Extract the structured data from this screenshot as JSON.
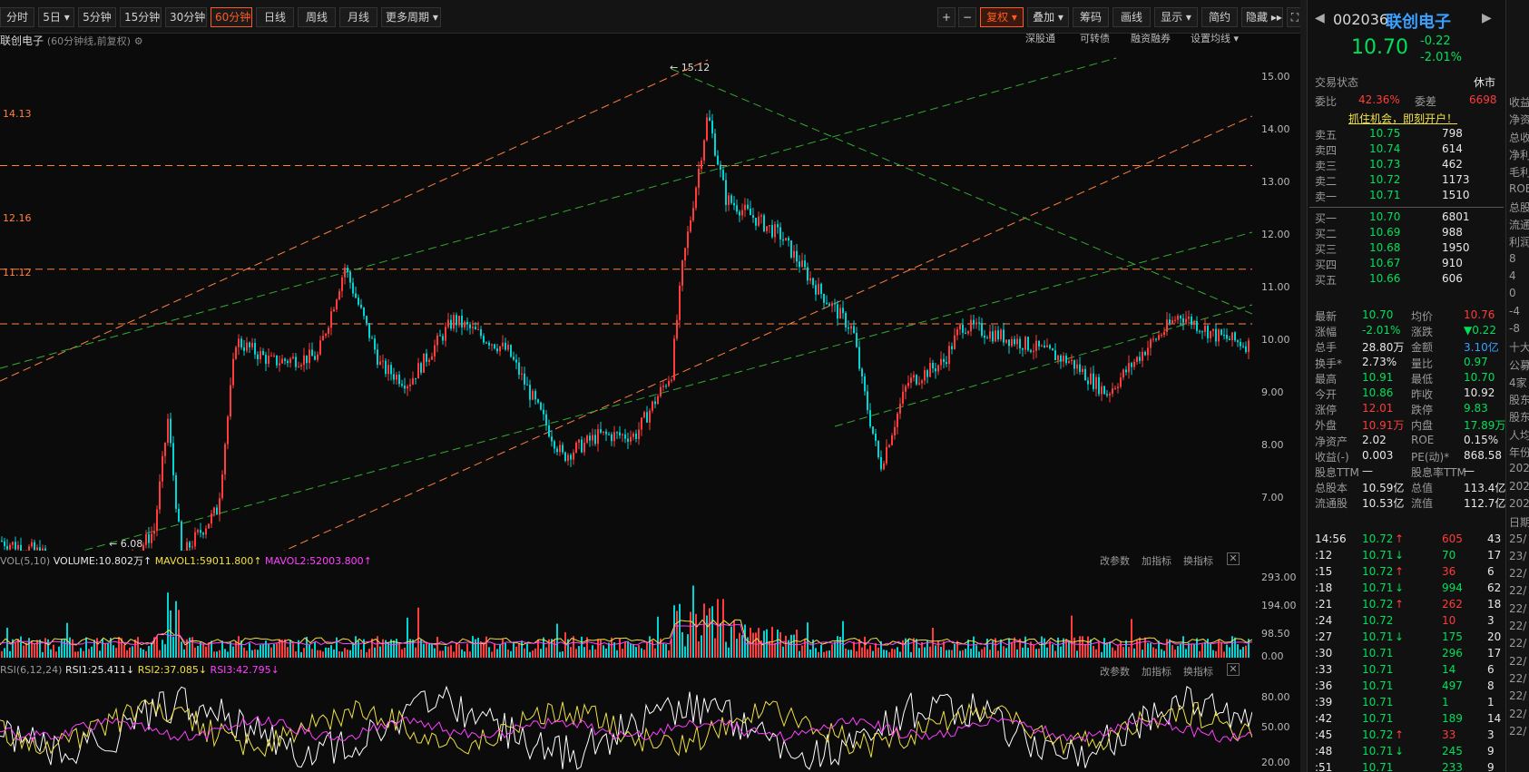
{
  "toolbar": {
    "periods": [
      "分时",
      "5日",
      "5分钟",
      "15分钟",
      "30分钟",
      "60分钟",
      "日线",
      "周线",
      "月线",
      "更多周期"
    ],
    "active_period": "60分钟",
    "tools": [
      "复权",
      "叠加",
      "筹码",
      "画线",
      "显示",
      "简约",
      "隐藏"
    ]
  },
  "chart": {
    "stock_name": "联创电子",
    "subtitle": "(60分钟线,前复权)",
    "links": [
      "深股通",
      "可转债",
      "融资融券",
      "设置均线"
    ],
    "price_axis": [
      "15.00",
      "14.00",
      "13.00",
      "12.00",
      "11.00",
      "10.00",
      "9.00",
      "8.00",
      "7.00"
    ],
    "hlines": [
      "14.13",
      "12.16",
      "11.12"
    ],
    "max_label": "15.12",
    "min_label": "6.08"
  },
  "volume_pane": {
    "name": "VOL(5,10)",
    "volume": "VOLUME:10.802万",
    "mavol1": "MAVOL1:59011.800",
    "mavol2": "MAVOL2:52003.800",
    "axis": [
      "293.00",
      "194.00",
      "98.50",
      "0.00"
    ],
    "tools": [
      "改参数",
      "加指标",
      "换指标"
    ]
  },
  "rsi_pane": {
    "name": "RSI(6,12,24)",
    "rsi1": "RSI1:25.411",
    "rsi2": "RSI2:37.085",
    "rsi3": "RSI3:42.795",
    "axis": [
      "80.00",
      "50.00",
      "20.00"
    ],
    "tools": [
      "改参数",
      "加指标",
      "换指标"
    ]
  },
  "quote": {
    "code": "002036",
    "name": "联创电子",
    "price": "10.70",
    "change": "-0.22",
    "change_pct": "-2.01%",
    "trade_status_label": "交易状态",
    "trade_status": "休市",
    "weibi_label": "委比",
    "weibi": "42.36%",
    "weicha_label": "委差",
    "weicha": "6698",
    "open_account": "抓住机会，即刻开户！",
    "sells": [
      {
        "label": "卖五",
        "price": "10.75",
        "vol": "798"
      },
      {
        "label": "卖四",
        "price": "10.74",
        "vol": "614"
      },
      {
        "label": "卖三",
        "price": "10.73",
        "vol": "462"
      },
      {
        "label": "卖二",
        "price": "10.72",
        "vol": "1173"
      },
      {
        "label": "卖一",
        "price": "10.71",
        "vol": "1510"
      }
    ],
    "buys": [
      {
        "label": "买一",
        "price": "10.70",
        "vol": "6801"
      },
      {
        "label": "买二",
        "price": "10.69",
        "vol": "988"
      },
      {
        "label": "买三",
        "price": "10.68",
        "vol": "1950"
      },
      {
        "label": "买四",
        "price": "10.67",
        "vol": "910"
      },
      {
        "label": "买五",
        "price": "10.66",
        "vol": "606"
      }
    ],
    "stats": [
      {
        "l1": "最新",
        "v1": "10.70",
        "c1": "green",
        "l2": "均价",
        "v2": "10.76",
        "c2": "red"
      },
      {
        "l1": "涨幅",
        "v1": "-2.01%",
        "c1": "green",
        "l2": "涨跌",
        "v2": "▼0.22",
        "c2": "green"
      },
      {
        "l1": "总手",
        "v1": "28.80万",
        "c1": "white",
        "l2": "金额",
        "v2": "3.10亿",
        "c2": "blue"
      },
      {
        "l1": "换手*",
        "v1": "2.73%",
        "c1": "white",
        "l2": "量比",
        "v2": "0.97",
        "c2": "green"
      },
      {
        "l1": "最高",
        "v1": "10.91",
        "c1": "green",
        "l2": "最低",
        "v2": "10.70",
        "c2": "green"
      },
      {
        "l1": "今开",
        "v1": "10.86",
        "c1": "green",
        "l2": "昨收",
        "v2": "10.92",
        "c2": "white"
      },
      {
        "l1": "涨停",
        "v1": "12.01",
        "c1": "red",
        "l2": "跌停",
        "v2": "9.83",
        "c2": "green"
      },
      {
        "l1": "外盘",
        "v1": "10.91万",
        "c1": "red",
        "l2": "内盘",
        "v2": "17.89万",
        "c2": "green"
      },
      {
        "l1": "净资产",
        "v1": "2.02",
        "c1": "white",
        "l2": "ROE",
        "v2": "0.15%",
        "c2": "white"
      },
      {
        "l1": "收益(-)",
        "v1": "0.003",
        "c1": "white",
        "l2": "PE(动)*",
        "v2": "868.58",
        "c2": "white"
      },
      {
        "l1": "股息TTM",
        "v1": "—",
        "c1": "white",
        "l2": "股息率TTM",
        "v2": "—",
        "c2": "white"
      },
      {
        "l1": "总股本",
        "v1": "10.59亿",
        "c1": "white",
        "l2": "总值",
        "v2": "113.4亿",
        "c2": "white"
      },
      {
        "l1": "流通股",
        "v1": "10.53亿",
        "c1": "white",
        "l2": "流值",
        "v2": "112.7亿",
        "c2": "white"
      }
    ],
    "ticks": [
      {
        "t": "14:56",
        "p": "10.72",
        "d": "up",
        "v": "605",
        "c": "red",
        "n": "43"
      },
      {
        "t": ":12",
        "p": "10.71",
        "d": "down",
        "v": "70",
        "c": "green",
        "n": "17"
      },
      {
        "t": ":15",
        "p": "10.72",
        "d": "up",
        "v": "36",
        "c": "red",
        "n": "6"
      },
      {
        "t": ":18",
        "p": "10.71",
        "d": "down",
        "v": "994",
        "c": "green",
        "n": "62"
      },
      {
        "t": ":21",
        "p": "10.72",
        "d": "up",
        "v": "262",
        "c": "red",
        "n": "18"
      },
      {
        "t": ":24",
        "p": "10.72",
        "d": "",
        "v": "10",
        "c": "red",
        "n": "3"
      },
      {
        "t": ":27",
        "p": "10.71",
        "d": "down",
        "v": "175",
        "c": "green",
        "n": "20"
      },
      {
        "t": ":30",
        "p": "10.71",
        "d": "",
        "v": "296",
        "c": "green",
        "n": "17"
      },
      {
        "t": ":33",
        "p": "10.71",
        "d": "",
        "v": "14",
        "c": "green",
        "n": "6"
      },
      {
        "t": ":36",
        "p": "10.71",
        "d": "",
        "v": "497",
        "c": "green",
        "n": "8"
      },
      {
        "t": ":39",
        "p": "10.71",
        "d": "",
        "v": "1",
        "c": "green",
        "n": "1"
      },
      {
        "t": ":42",
        "p": "10.71",
        "d": "",
        "v": "189",
        "c": "green",
        "n": "14"
      },
      {
        "t": ":45",
        "p": "10.72",
        "d": "up",
        "v": "33",
        "c": "red",
        "n": "3"
      },
      {
        "t": ":48",
        "p": "10.71",
        "d": "down",
        "v": "245",
        "c": "green",
        "n": "9"
      },
      {
        "t": ":51",
        "p": "10.71",
        "d": "",
        "v": "233",
        "c": "green",
        "n": "9"
      }
    ],
    "cut_labels": [
      "收益",
      "净资",
      "总收",
      "净利",
      "毛利",
      "ROE",
      "总股",
      "流通",
      "利润",
      "8",
      "4",
      "0",
      "-4",
      "-8",
      "十大",
      "公募",
      "4家",
      "股东",
      "股东",
      "人均",
      "年份",
      "202",
      "202",
      "202",
      "日期",
      "25/",
      "23/",
      "22/",
      "22/",
      "22/",
      "22/",
      "22/",
      "22/",
      "22/",
      "22/",
      "22/",
      "22/"
    ]
  },
  "colors": {
    "up": "#ff3b3b",
    "down": "#00d5d5",
    "orange_line": "#ff8040",
    "green_line": "#33aa33"
  }
}
